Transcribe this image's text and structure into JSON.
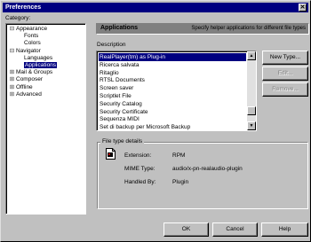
{
  "window": {
    "title": "Preferences",
    "close_glyph": "✕"
  },
  "category_label": "Category:",
  "tree": [
    {
      "label": "Appearance",
      "toggle": "⊟",
      "selected": false
    },
    {
      "label": "Fonts",
      "toggle": "",
      "selected": false
    },
    {
      "label": "Colors",
      "toggle": "",
      "selected": false
    },
    {
      "label": "Navigator",
      "toggle": "⊟",
      "selected": false
    },
    {
      "label": "Languages",
      "toggle": "",
      "selected": false
    },
    {
      "label": "Applications",
      "toggle": "",
      "selected": true
    },
    {
      "label": "Mail & Groups",
      "toggle": "⊞",
      "selected": false
    },
    {
      "label": "Composer",
      "toggle": "⊞",
      "selected": false
    },
    {
      "label": "Offline",
      "toggle": "⊞",
      "selected": false
    },
    {
      "label": "Advanced",
      "toggle": "⊞",
      "selected": false
    }
  ],
  "panel": {
    "title": "Applications",
    "subtitle": "Specify helper applications for different file types",
    "description_label": "Description"
  },
  "app_list": [
    {
      "label": "RealPlayer(tm) as Plug-in",
      "selected": true
    },
    {
      "label": "Ricerca salvata",
      "selected": false
    },
    {
      "label": "Ritaglio",
      "selected": false
    },
    {
      "label": "RTSL Documents",
      "selected": false
    },
    {
      "label": "Screen saver",
      "selected": false
    },
    {
      "label": "Scriptlet File",
      "selected": false
    },
    {
      "label": "Security Catalog",
      "selected": false
    },
    {
      "label": "Security Certificate",
      "selected": false
    },
    {
      "label": "Sequenza MIDI",
      "selected": false
    },
    {
      "label": "Set di backup per Microsoft Backup",
      "selected": false
    }
  ],
  "buttons": {
    "new_type": "New Type...",
    "edit": "Edit...",
    "remove": "Remove..."
  },
  "file_type_details": {
    "group_title": "File type details",
    "extension_label": "Extension:",
    "extension_value": "RPM",
    "mime_label": "MIME Type:",
    "mime_value": "audio/x-pn-realaudio-plugin",
    "handled_label": "Handled By:",
    "handled_value": "Plugin"
  },
  "dialog_buttons": {
    "ok": "OK",
    "cancel": "Cancel",
    "help": "Help"
  }
}
